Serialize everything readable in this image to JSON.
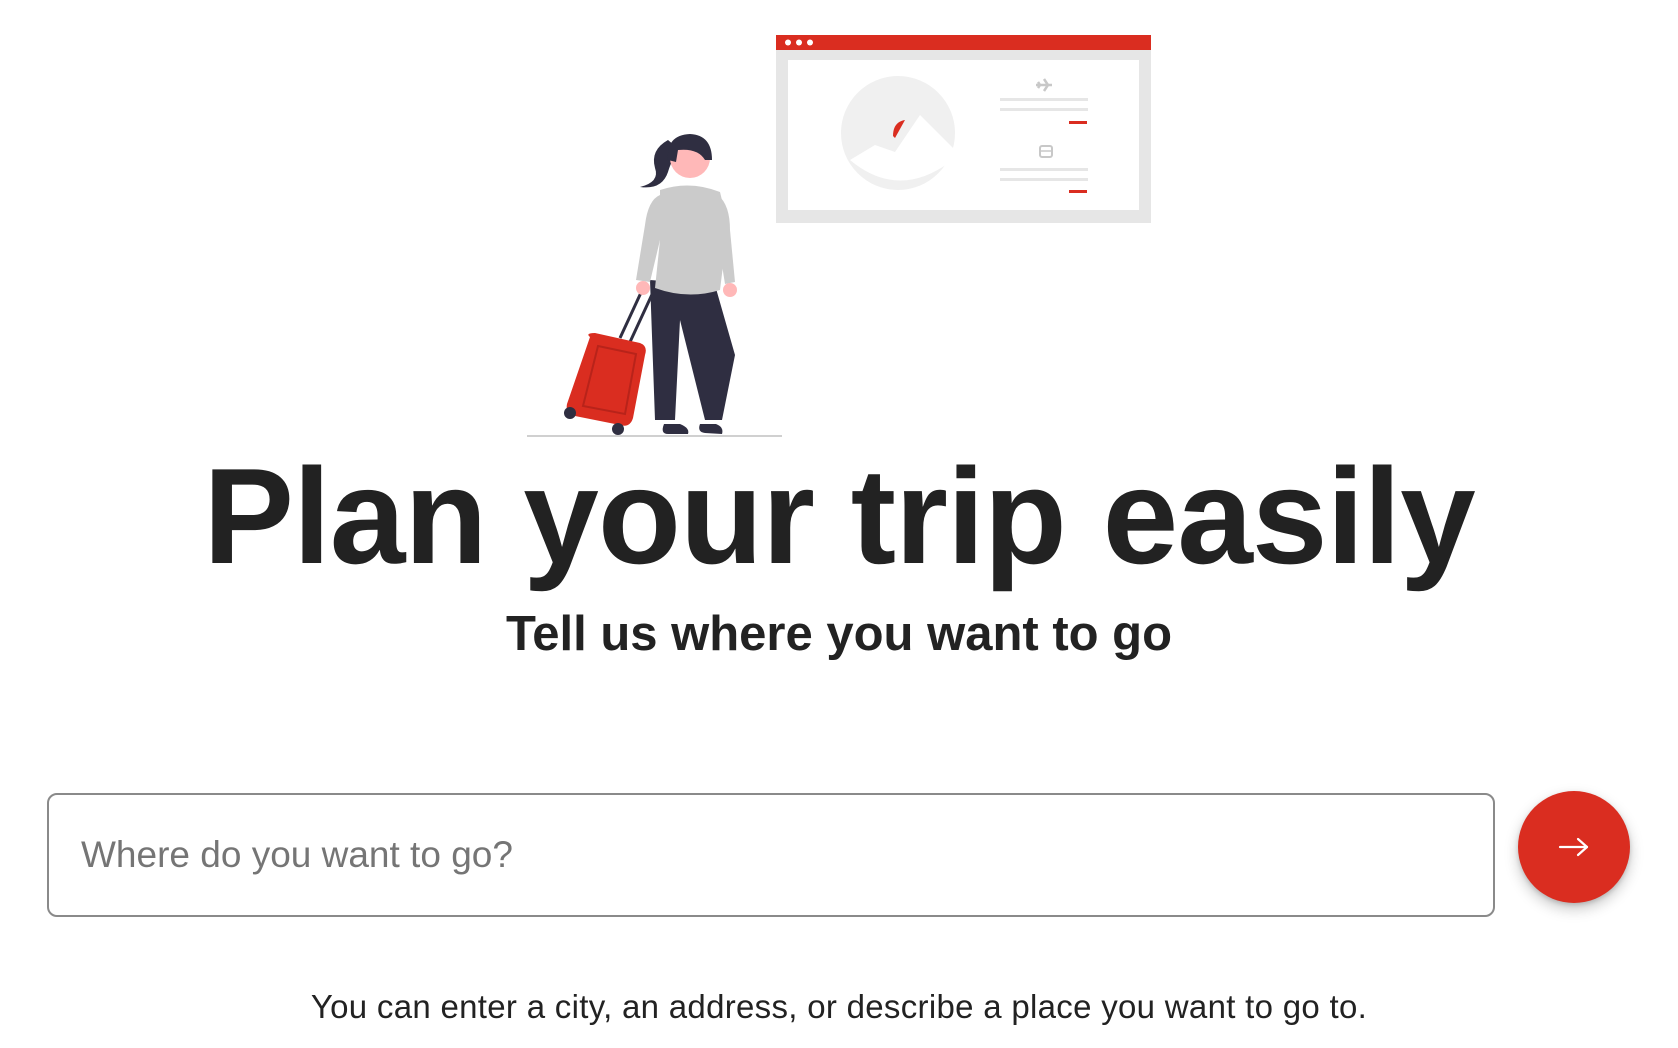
{
  "hero": {
    "title": "Plan your trip easily",
    "subtitle": "Tell us where you want to go"
  },
  "search": {
    "placeholder": "Where do you want to go?",
    "value": "",
    "submit_icon": "arrow-right-icon"
  },
  "helper_text": "You can enter a city, an address, or describe a place you want to go to.",
  "illustration": {
    "description_icons": [
      "traveler-woman",
      "red-suitcase",
      "browser-window",
      "airplane-icon",
      "train-icon",
      "landscape-photo"
    ]
  },
  "colors": {
    "accent": "#da2d20",
    "text": "#222222",
    "placeholder": "#757575",
    "input_border": "#8a8a8a",
    "illustration_gray": "#e6e6e6",
    "figure_dark": "#2f2e41"
  }
}
